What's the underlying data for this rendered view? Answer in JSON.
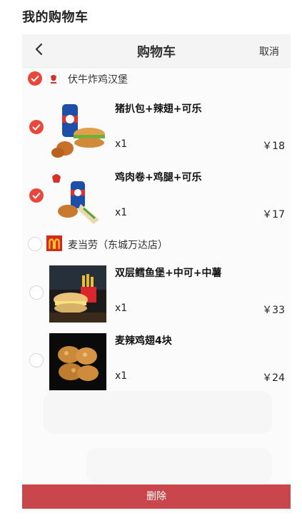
{
  "page": {
    "title": "我的购物车"
  },
  "nav": {
    "title": "购物车",
    "cancel_label": "取消"
  },
  "stores": [
    {
      "name": "伏牛炸鸡汉堡",
      "checked": true,
      "items": [
        {
          "name": "猪扒包+辣翅+可乐",
          "qty": "x1",
          "price": "￥18",
          "checked": true
        },
        {
          "name": "鸡肉卷+鸡腿+可乐",
          "qty": "x1",
          "price": "￥17",
          "checked": true
        }
      ]
    },
    {
      "name": "麦当劳（东城万达店）",
      "checked": false,
      "items": [
        {
          "name": "双层鳕鱼堡+中可+中薯",
          "qty": "x1",
          "price": "￥33",
          "checked": false
        },
        {
          "name": "麦辣鸡翅4块",
          "qty": "x1",
          "price": "￥24",
          "checked": false
        }
      ]
    }
  ],
  "footer": {
    "delete_label": "删除"
  },
  "colors": {
    "accent": "#e8483c",
    "delete_bar": "#c8464c"
  }
}
